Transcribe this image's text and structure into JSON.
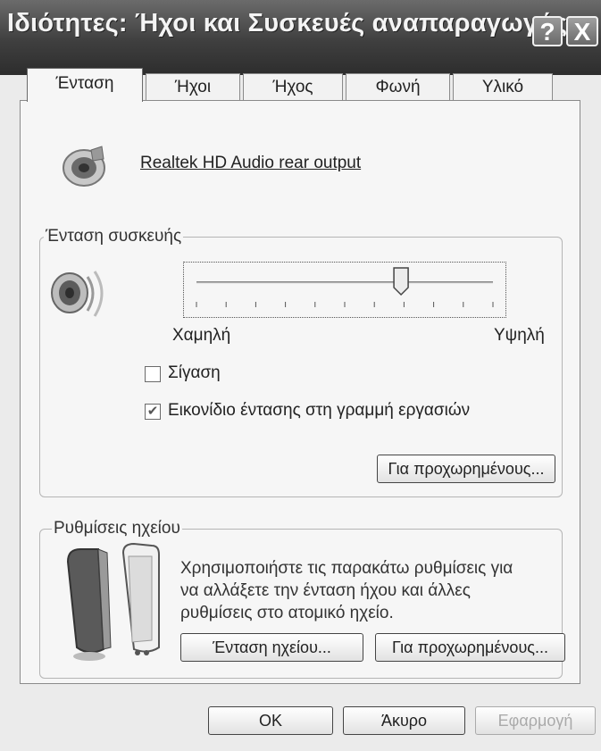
{
  "window": {
    "title": "Ιδιότητες: Ήχοι και Συσκευές αναπαραγωγής",
    "help_button": "?",
    "close_button": "X"
  },
  "tabs": [
    {
      "label": "Ένταση",
      "active": true
    },
    {
      "label": "Ήχοι",
      "active": false
    },
    {
      "label": "Ήχος",
      "active": false
    },
    {
      "label": "Φωνή",
      "active": false
    },
    {
      "label": "Υλικό",
      "active": false
    }
  ],
  "device": {
    "name": "Realtek HD Audio rear output",
    "icon": "speaker-settings-icon"
  },
  "device_volume": {
    "legend": "Ένταση συσκευής",
    "icon": "speaker-icon",
    "slider_value": 0.69,
    "low_label": "Χαμηλή",
    "high_label": "Υψηλή",
    "mute_label": "Σίγαση",
    "mute_checked": false,
    "tray_icon_label": "Εικονίδιο έντασης στη γραμμή εργασιών",
    "tray_icon_checked": true,
    "advanced_button": "Για προχωρημένους..."
  },
  "speaker_settings": {
    "legend": "Ρυθμίσεις ηχείου",
    "icon": "speakers-icon",
    "description": [
      "Χρησιμοποιήστε τις παρακάτω ρυθμίσεις για",
      "να αλλάξετε την ένταση ήχου και άλλες",
      "ρυθμίσεις στο ατομικό ηχείο."
    ],
    "speaker_volume_button": "Ένταση ηχείου...",
    "advanced_button": "Για προχωρημένους..."
  },
  "footer": {
    "ok": "OK",
    "cancel": "Άκυρο",
    "apply": "Εφαρμογή",
    "apply_enabled": false
  }
}
